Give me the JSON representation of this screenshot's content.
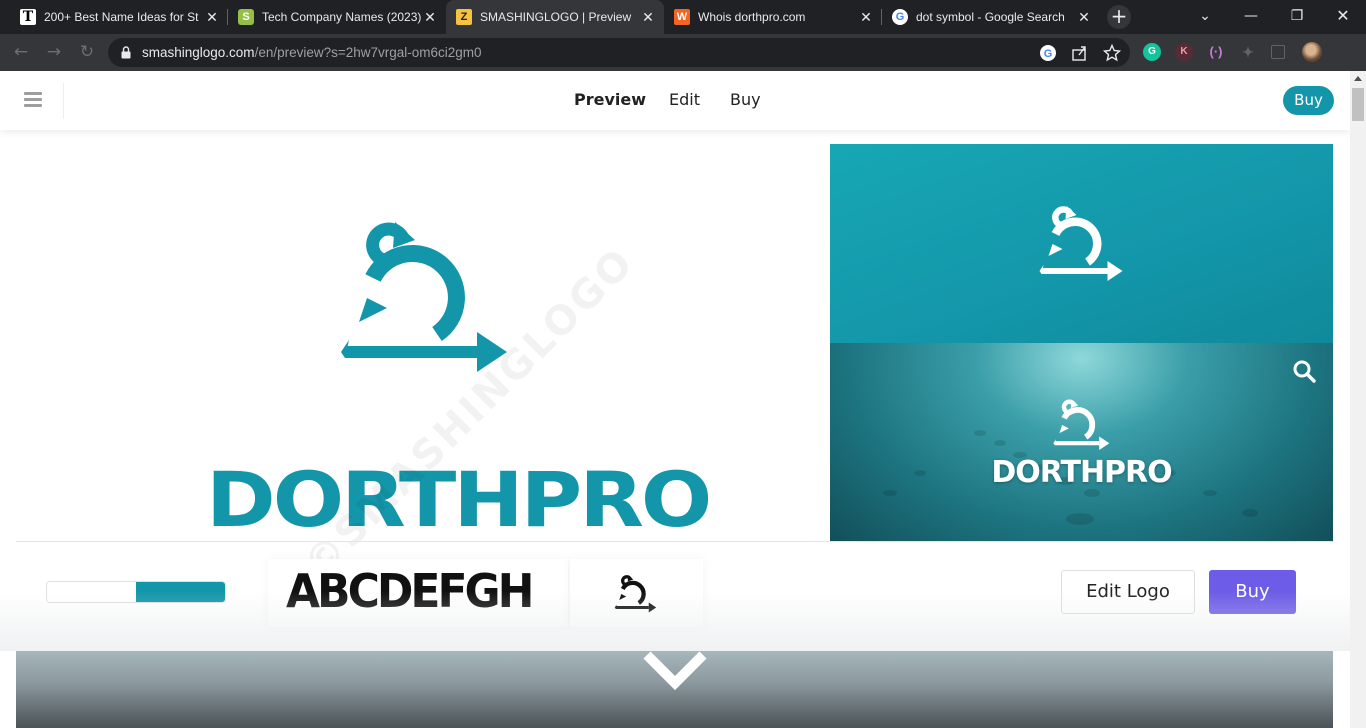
{
  "browser": {
    "tabs": [
      {
        "title": "200+ Best Name Ideas for St",
        "favicon": "T",
        "active": false
      },
      {
        "title": "Tech Company Names (2023)",
        "favicon": "shopify-icon",
        "active": false
      },
      {
        "title": "SMASHINGLOGO | Preview",
        "favicon": "smashinglogo-icon",
        "active": true
      },
      {
        "title": "Whois dorthpro.com",
        "favicon": "whois-icon",
        "active": false
      },
      {
        "title": "dot symbol - Google Search",
        "favicon": "google-icon",
        "active": false
      }
    ],
    "url_host": "smashinglogo.com",
    "url_path": "/en/preview?s=2hw7vrgal-om6ci2gm0",
    "extensions": [
      "G",
      "K"
    ]
  },
  "site": {
    "nav": {
      "preview": "Preview",
      "edit": "Edit",
      "buy": "Buy"
    },
    "buy_pill": "Buy"
  },
  "logo": {
    "brand_name": "DORTHPRO",
    "brand_color": "#1396a9",
    "watermark": "©SMASHINGLOGO"
  },
  "mockup": {
    "brand_name": "DORTHPRO"
  },
  "options": {
    "colors": [
      "#ffffff",
      "#1396a9"
    ],
    "font_sample": "ABCDEFGH",
    "edit_logo": "Edit Logo",
    "buy": "Buy",
    "buy_color": "#6c5ce7"
  }
}
